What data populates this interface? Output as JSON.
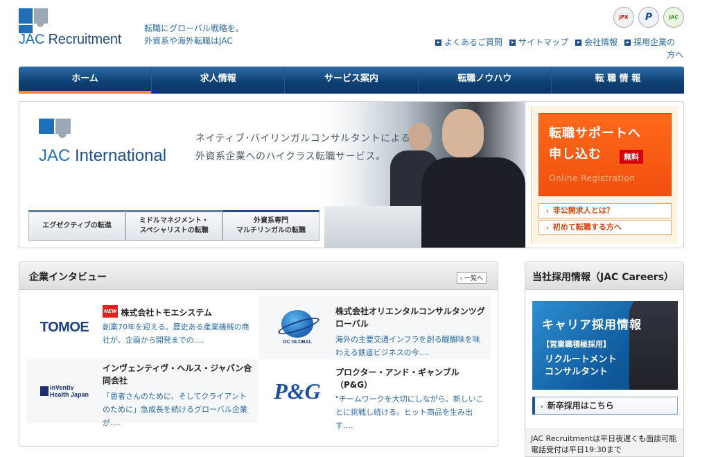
{
  "header": {
    "brand_jac": "JAC",
    "brand_rest": " Recruitment",
    "tagline_1": "転職にグローバル戦略を。",
    "tagline_2": "外資系や海外転職はJAC",
    "badges": [
      "JPX",
      "P",
      "JAC"
    ],
    "links": [
      "よくあるご質問",
      "サイトマップ",
      "会社情報",
      "採用企業の"
    ],
    "links_wrap": "方へ"
  },
  "nav": {
    "items": [
      "ホーム",
      "求人情報",
      "サービス案内",
      "転職ノウハウ",
      "転 職 情 報"
    ]
  },
  "hero": {
    "brand_jac": "JAC",
    "brand_rest": " International",
    "copy_1": "ネイティブ･バイリンガルコンサルタントによる",
    "copy_2": "外資系企業へのハイクラス転職サービス。",
    "tabs": [
      {
        "l1": "エグゼクティブの転進",
        "l2": ""
      },
      {
        "l1": "ミドルマネジメント・",
        "l2": "スペシャリストの転職"
      },
      {
        "l1": "外資系専門",
        "l2": "マルチリンガルの転職"
      }
    ],
    "register": {
      "line1": "転職サポートへ",
      "line2": "申し込む",
      "free": "無料",
      "en": "Online Registration",
      "link_a": "非公開求人とは？",
      "link_b": "初めて転職する方へ"
    }
  },
  "interviews": {
    "title": "企業インタビュー",
    "more": "一覧へ",
    "items": [
      {
        "logo": "TOMOE",
        "new": "NEW",
        "name": "株式会社トモエシステム",
        "desc": "創業70年を迎える、歴史ある産業機械の商社が、企画から開発までの…."
      },
      {
        "logo": "OC GLOBAL",
        "name": "株式会社オリエンタルコンサルタンツグローバル",
        "desc": "海外の主要交通インフラを創る醍醐味を味わえる鉄道ビジネスの今…."
      },
      {
        "logo_1": "inVentiv",
        "logo_2": "Health Japan",
        "name": "インヴェンティヴ・ヘルス・ジャパン合同会社",
        "desc": "「患者さんのために、そしてクライアントのために」急成長を続けるグローバル企業が…."
      },
      {
        "logo": "P&G",
        "name": "プロクター・アンド・ギャンブル（P&G）",
        "desc": "\"チームワークを大切にしながら、新しいことに挑戦し続ける。ヒット商品を生み出す…."
      }
    ]
  },
  "careers": {
    "title": "当社採用情報（JAC Careers）",
    "banner_1": "キャリア採用情報",
    "banner_2": "【営業職積極採用】",
    "banner_3": "リクルートメント",
    "banner_4": "コンサルタント",
    "newgrad": "新卒採用はこちら",
    "note_1": "JAC Recruitmentは平日夜遅くも面談可能",
    "note_2": "電話受付は平日19:30まで"
  },
  "colors": {
    "navy": "#0d3f73",
    "accent_orange": "#f24f0f",
    "link_blue": "#2a6aa7"
  }
}
